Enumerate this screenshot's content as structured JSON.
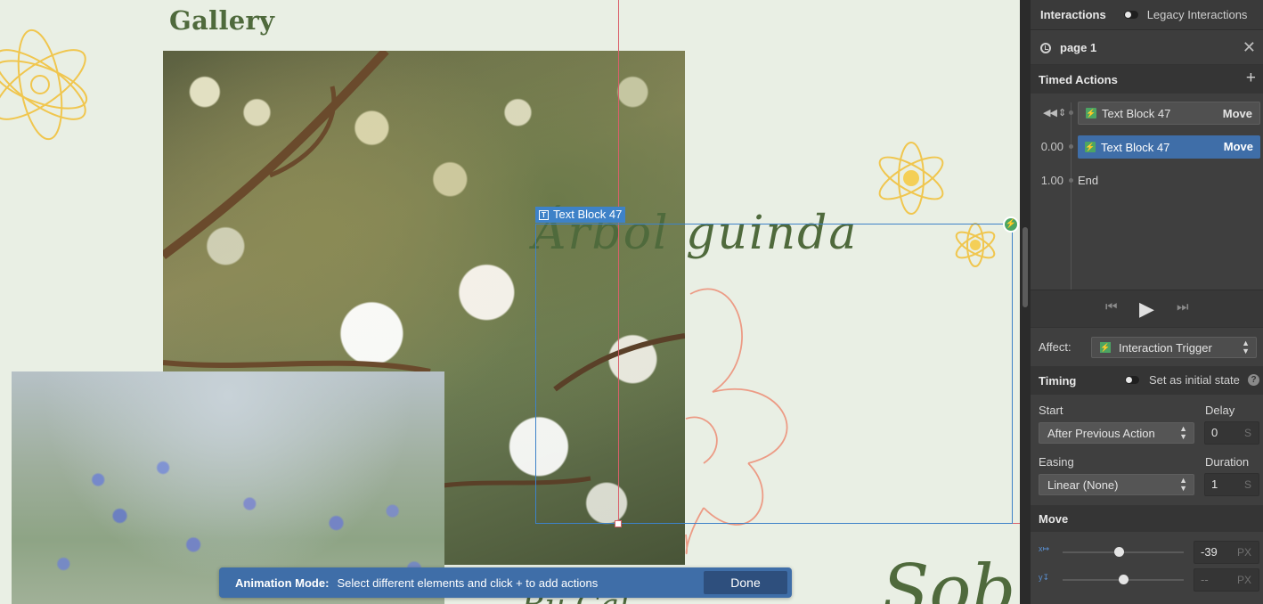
{
  "canvas": {
    "gallery_title": "Gallery",
    "script_heading": "Árbol guinda",
    "script_bottom_left": "Bu Cal",
    "script_bottom_right": "Sob",
    "selected_element_label": "Text Block 47",
    "animation_bar": {
      "mode_label": "Animation Mode:",
      "hint": "Select different elements and click + to add actions",
      "done_label": "Done"
    }
  },
  "panel": {
    "tab_interactions": "Interactions",
    "legacy_label": "Legacy Interactions",
    "page_name": "page 1",
    "timed_actions_header": "Timed Actions",
    "timeline": [
      {
        "time": "",
        "element": "Text Block 47",
        "action": "Move"
      },
      {
        "time": "0.00",
        "element": "Text Block 47",
        "action": "Move"
      },
      {
        "time": "1.00",
        "label": "End"
      }
    ],
    "affect_label": "Affect:",
    "affect_value": "Interaction Trigger",
    "timing_header": "Timing",
    "initial_state_label": "Set as initial state",
    "start_label": "Start",
    "start_value": "After Previous Action",
    "delay_label": "Delay",
    "delay_value": "0",
    "delay_unit": "S",
    "easing_label": "Easing",
    "easing_value": "Linear (None)",
    "duration_label": "Duration",
    "duration_value": "1",
    "duration_unit": "S",
    "move_header": "Move",
    "move_x_value": "-39",
    "move_x_unit": "PX",
    "move_y_value": "--",
    "move_y_unit": "PX",
    "move_x_slider_fraction": 0.46,
    "move_y_slider_fraction": 0.5
  },
  "colors": {
    "canvas_bg": "#e9efe4",
    "heading_green": "#4f6a3c",
    "selection_blue": "#3e82c8",
    "guide_red": "#d9606a",
    "accent_blue": "#3f6ea8",
    "trigger_green": "#4ca563"
  }
}
